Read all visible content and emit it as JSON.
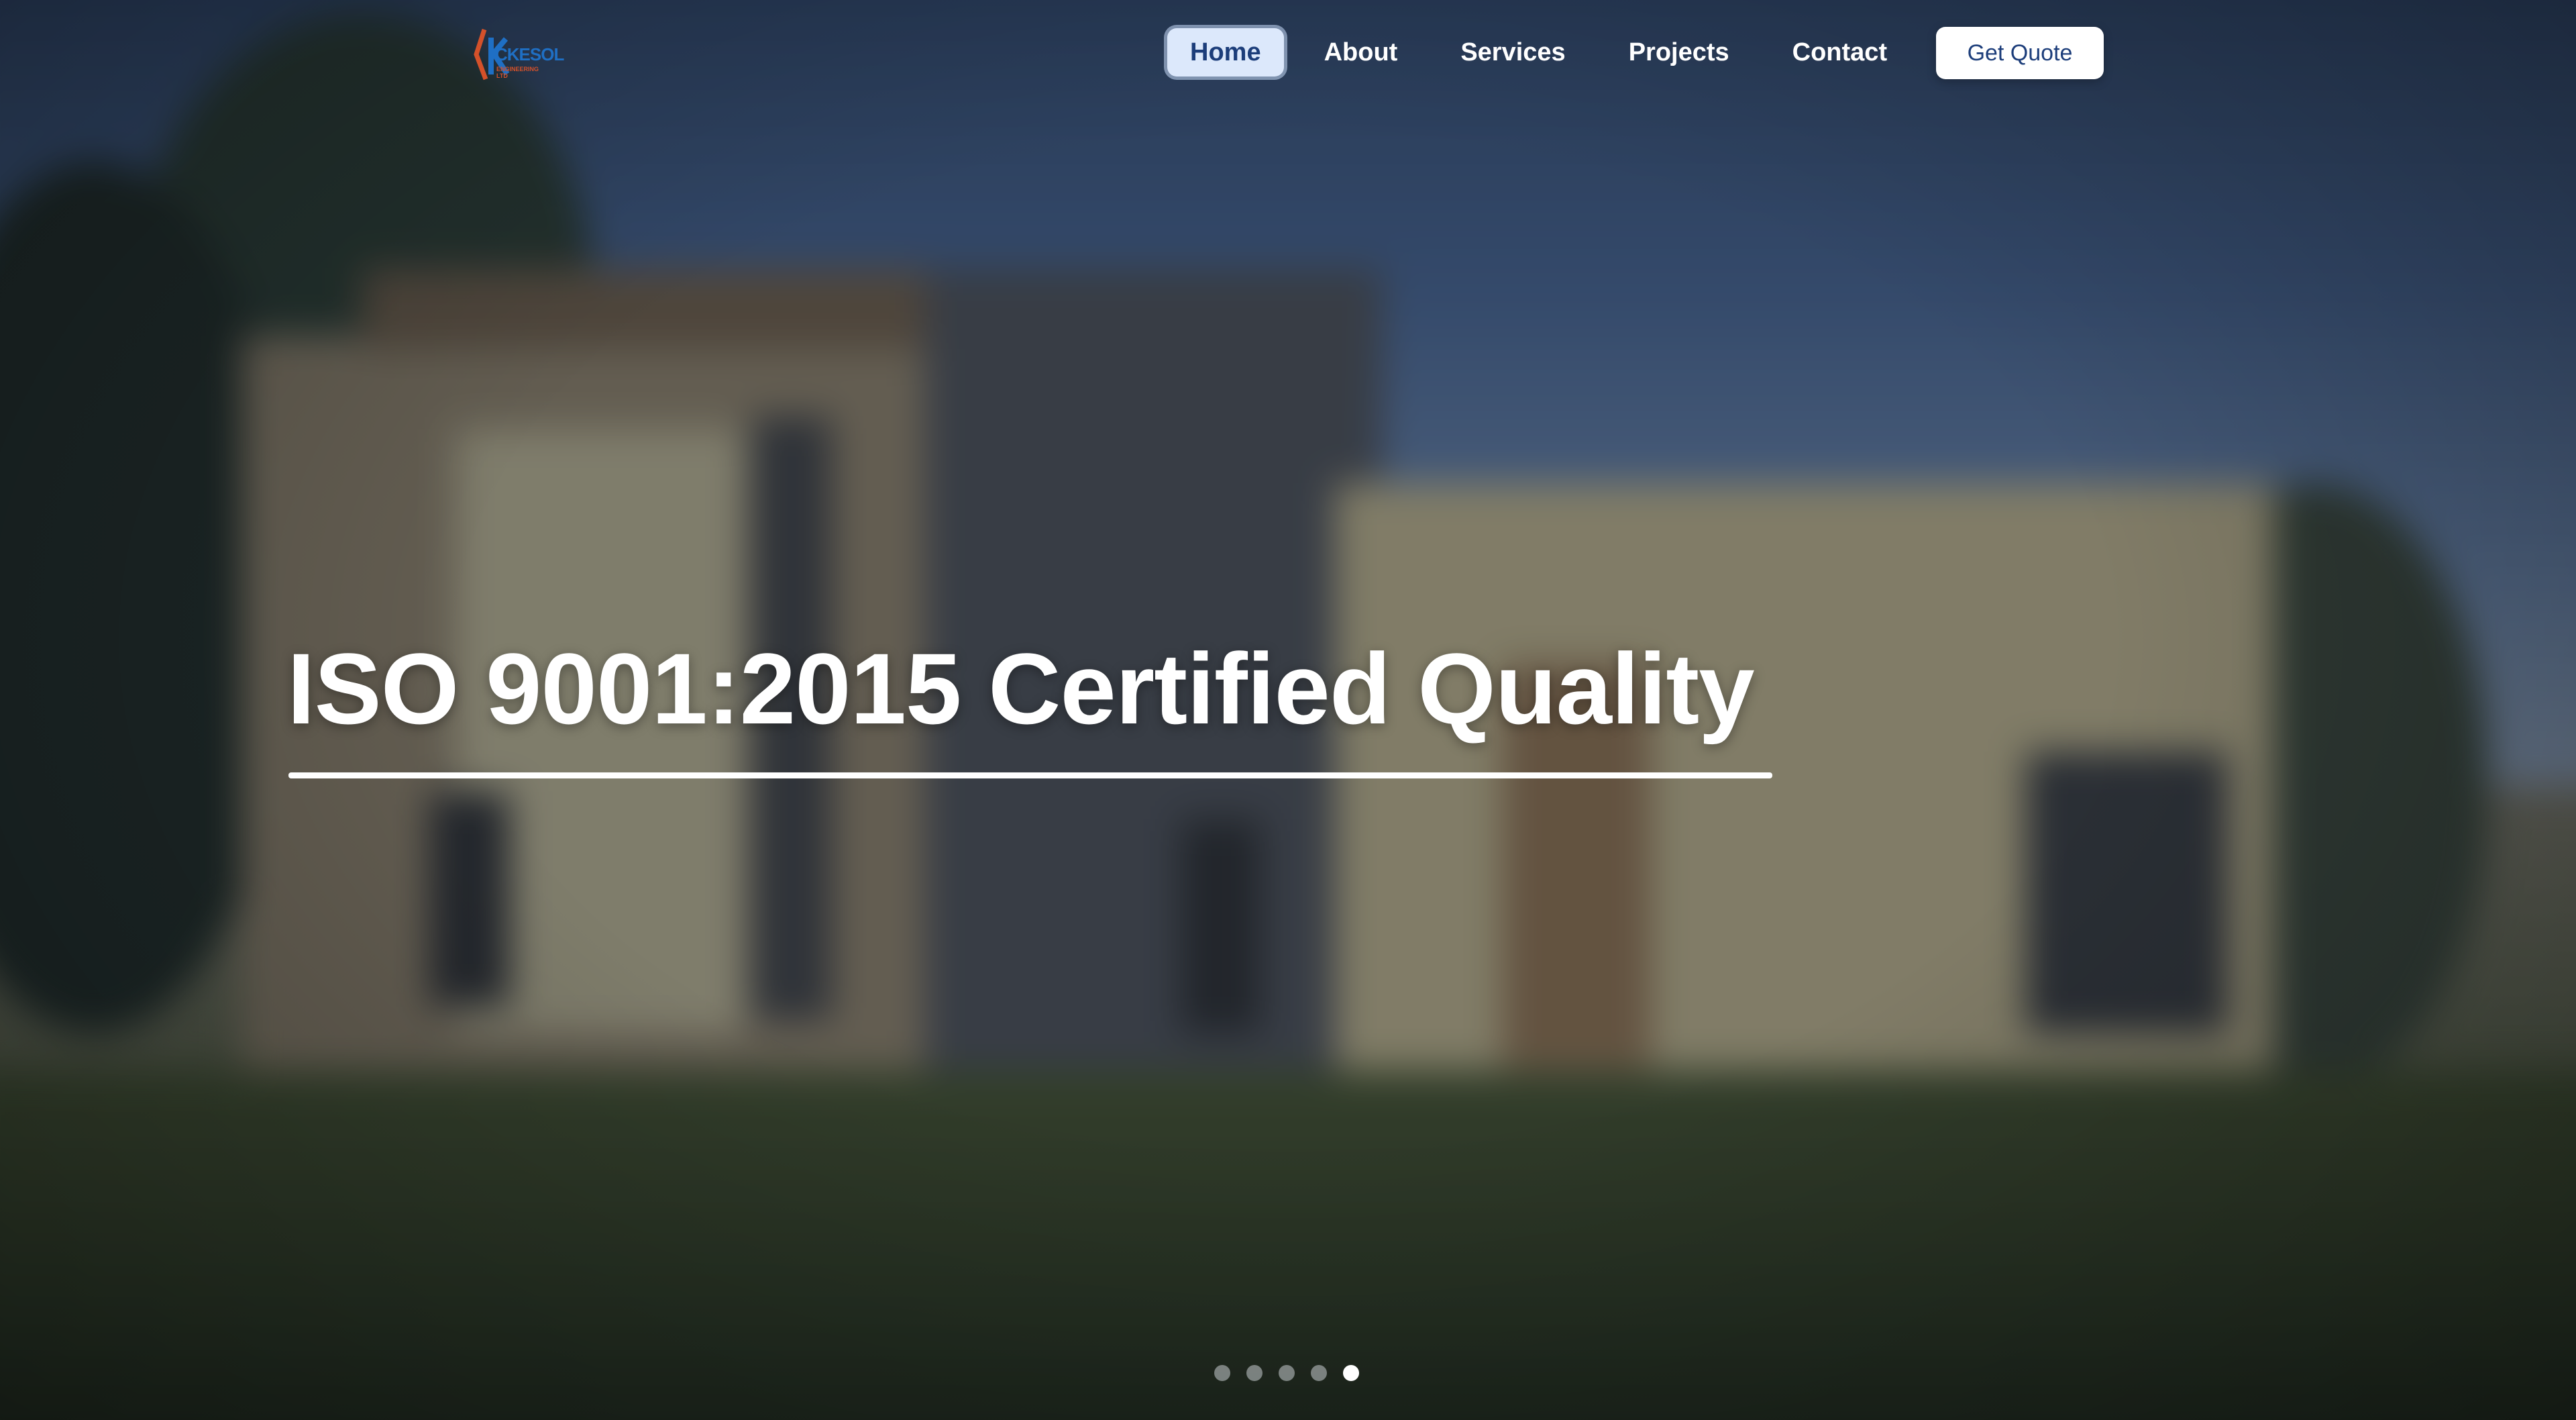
{
  "nav": {
    "logo_text": "CKESOL",
    "logo_sub": "ENGINEERING LTD",
    "links": [
      {
        "label": "Home",
        "active": true
      },
      {
        "label": "About",
        "active": false
      },
      {
        "label": "Services",
        "active": false
      },
      {
        "label": "Projects",
        "active": false
      },
      {
        "label": "Contact",
        "active": false
      }
    ],
    "cta_label": "Get Quote"
  },
  "hero": {
    "headline": "ISO 9001:2015 Certified Quality",
    "slide_count": 5,
    "active_slide": 5
  },
  "colors": {
    "accent_navy": "#1c3d7a",
    "active_pill": "#dce8fb",
    "logo_blue": "#1f6fc4",
    "logo_orange": "#d4512a"
  }
}
